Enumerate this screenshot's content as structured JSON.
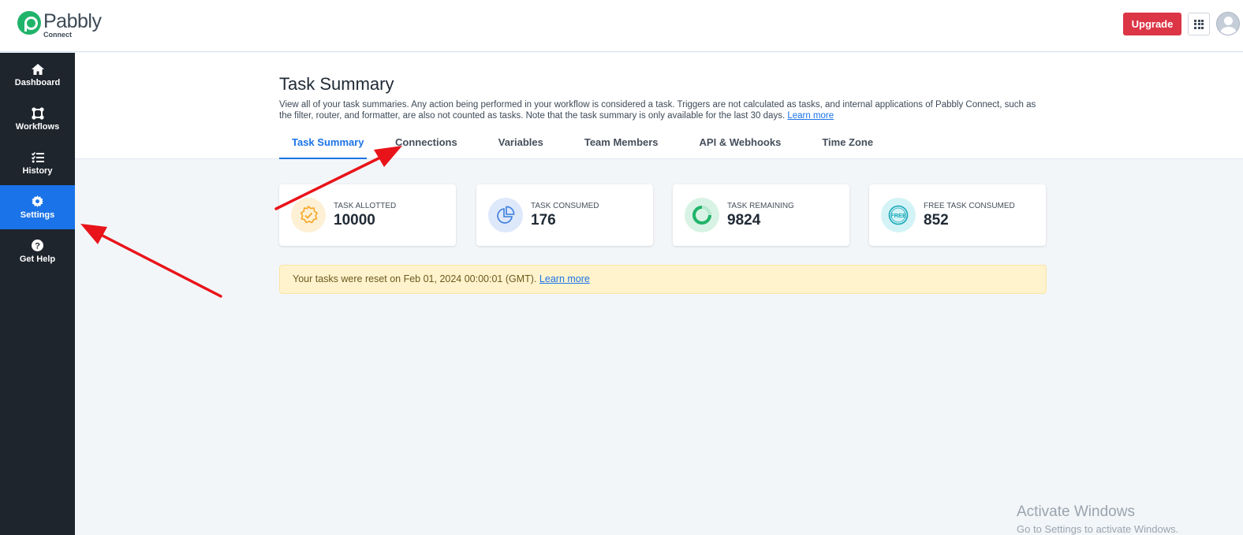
{
  "brand": {
    "name": "Pabbly",
    "sub": "Connect"
  },
  "header": {
    "upgrade_label": "Upgrade"
  },
  "sidebar": {
    "items": [
      {
        "label": "Dashboard",
        "icon": "home-icon"
      },
      {
        "label": "Workflows",
        "icon": "workflows-icon"
      },
      {
        "label": "History",
        "icon": "history-icon"
      },
      {
        "label": "Settings",
        "icon": "gear-icon",
        "active": true
      },
      {
        "label": "Get Help",
        "icon": "help-icon"
      }
    ]
  },
  "main": {
    "title": "Task Summary",
    "description": "View all of your task summaries. Any action being performed in your workflow is considered a task. Triggers are not calculated as tasks, and internal applications of Pabbly Connect, such as the filter, router, and formatter, are also not counted as tasks. Note that the task summary is only available for the last 30 days.",
    "learn_more": "Learn more",
    "tabs": [
      {
        "label": "Task Summary",
        "active": true
      },
      {
        "label": "Connections"
      },
      {
        "label": "Variables"
      },
      {
        "label": "Team Members"
      },
      {
        "label": "API & Webhooks"
      },
      {
        "label": "Time Zone"
      }
    ],
    "cards": [
      {
        "label": "TASK ALLOTTED",
        "value": "10000",
        "icon": "badge-check-icon",
        "color": "#f5a623",
        "bg": "#fdf0d5"
      },
      {
        "label": "TASK CONSUMED",
        "value": "176",
        "icon": "pie-chart-icon",
        "color": "#3b7ddd",
        "bg": "#dde8fb"
      },
      {
        "label": "TASK REMAINING",
        "value": "9824",
        "icon": "progress-ring-icon",
        "color": "#20b46a",
        "bg": "#d8f3e5"
      },
      {
        "label": "FREE TASK CONSUMED",
        "value": "852",
        "icon": "free-badge-icon",
        "color": "#14a6b8",
        "bg": "#d4f3f6"
      }
    ],
    "notice": {
      "text": "Your tasks were reset on Feb 01, 2024 00:00:01 (GMT).",
      "link": "Learn more"
    }
  },
  "watermark": {
    "title": "Activate Windows",
    "subtitle": "Go to Settings to activate Windows."
  },
  "colors": {
    "primary": "#1a73e8",
    "danger": "#dc3545",
    "sidebar": "#1e252d",
    "arrow": "#e8141a"
  }
}
